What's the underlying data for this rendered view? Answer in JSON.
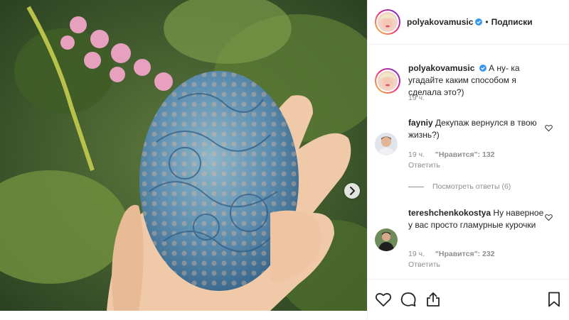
{
  "post": {
    "author": "polyakovamusic",
    "follow_label": "Подписки",
    "dot": "•",
    "caption": "А ну- ка угадайте каким способом я сделала это?)",
    "caption_time": "19 ч."
  },
  "comments": [
    {
      "username": "fayniy",
      "text": "Декупаж вернулся в твою жизнь?)",
      "time": "19 ч.",
      "likes": "\"Нравится\": 132",
      "reply": "Ответить"
    },
    {
      "username": "tereshchenkokostya",
      "text": "Ну наверное у вас просто гламурные курочки",
      "time": "19 ч.",
      "likes": "\"Нравится\": 232",
      "reply": "Ответить"
    }
  ],
  "view_replies": "Посмотреть ответы (6)",
  "icons": {
    "verified": "verified-badge-icon",
    "like": "heart-icon",
    "comment": "comment-icon",
    "share": "share-icon",
    "save": "bookmark-icon",
    "next": "chevron-right-icon"
  },
  "colors": {
    "verified": "#3897f0",
    "text": "#262626",
    "muted": "#8e8e8e"
  }
}
